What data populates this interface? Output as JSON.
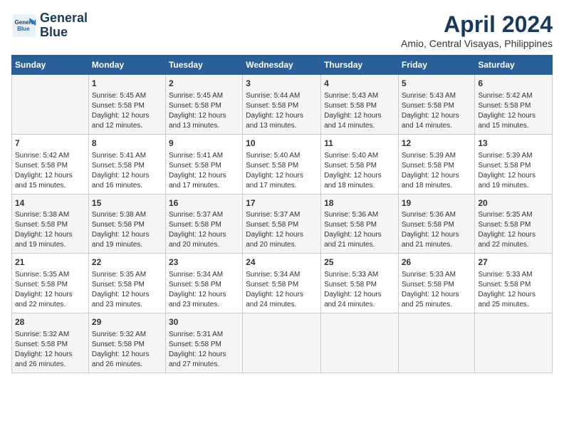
{
  "logo": {
    "line1": "General",
    "line2": "Blue"
  },
  "title": "April 2024",
  "subtitle": "Amio, Central Visayas, Philippines",
  "headers": [
    "Sunday",
    "Monday",
    "Tuesday",
    "Wednesday",
    "Thursday",
    "Friday",
    "Saturday"
  ],
  "weeks": [
    [
      {
        "day": "",
        "text": ""
      },
      {
        "day": "1",
        "text": "Sunrise: 5:45 AM\nSunset: 5:58 PM\nDaylight: 12 hours\nand 12 minutes."
      },
      {
        "day": "2",
        "text": "Sunrise: 5:45 AM\nSunset: 5:58 PM\nDaylight: 12 hours\nand 13 minutes."
      },
      {
        "day": "3",
        "text": "Sunrise: 5:44 AM\nSunset: 5:58 PM\nDaylight: 12 hours\nand 13 minutes."
      },
      {
        "day": "4",
        "text": "Sunrise: 5:43 AM\nSunset: 5:58 PM\nDaylight: 12 hours\nand 14 minutes."
      },
      {
        "day": "5",
        "text": "Sunrise: 5:43 AM\nSunset: 5:58 PM\nDaylight: 12 hours\nand 14 minutes."
      },
      {
        "day": "6",
        "text": "Sunrise: 5:42 AM\nSunset: 5:58 PM\nDaylight: 12 hours\nand 15 minutes."
      }
    ],
    [
      {
        "day": "7",
        "text": "Sunrise: 5:42 AM\nSunset: 5:58 PM\nDaylight: 12 hours\nand 15 minutes."
      },
      {
        "day": "8",
        "text": "Sunrise: 5:41 AM\nSunset: 5:58 PM\nDaylight: 12 hours\nand 16 minutes."
      },
      {
        "day": "9",
        "text": "Sunrise: 5:41 AM\nSunset: 5:58 PM\nDaylight: 12 hours\nand 17 minutes."
      },
      {
        "day": "10",
        "text": "Sunrise: 5:40 AM\nSunset: 5:58 PM\nDaylight: 12 hours\nand 17 minutes."
      },
      {
        "day": "11",
        "text": "Sunrise: 5:40 AM\nSunset: 5:58 PM\nDaylight: 12 hours\nand 18 minutes."
      },
      {
        "day": "12",
        "text": "Sunrise: 5:39 AM\nSunset: 5:58 PM\nDaylight: 12 hours\nand 18 minutes."
      },
      {
        "day": "13",
        "text": "Sunrise: 5:39 AM\nSunset: 5:58 PM\nDaylight: 12 hours\nand 19 minutes."
      }
    ],
    [
      {
        "day": "14",
        "text": "Sunrise: 5:38 AM\nSunset: 5:58 PM\nDaylight: 12 hours\nand 19 minutes."
      },
      {
        "day": "15",
        "text": "Sunrise: 5:38 AM\nSunset: 5:58 PM\nDaylight: 12 hours\nand 19 minutes."
      },
      {
        "day": "16",
        "text": "Sunrise: 5:37 AM\nSunset: 5:58 PM\nDaylight: 12 hours\nand 20 minutes."
      },
      {
        "day": "17",
        "text": "Sunrise: 5:37 AM\nSunset: 5:58 PM\nDaylight: 12 hours\nand 20 minutes."
      },
      {
        "day": "18",
        "text": "Sunrise: 5:36 AM\nSunset: 5:58 PM\nDaylight: 12 hours\nand 21 minutes."
      },
      {
        "day": "19",
        "text": "Sunrise: 5:36 AM\nSunset: 5:58 PM\nDaylight: 12 hours\nand 21 minutes."
      },
      {
        "day": "20",
        "text": "Sunrise: 5:35 AM\nSunset: 5:58 PM\nDaylight: 12 hours\nand 22 minutes."
      }
    ],
    [
      {
        "day": "21",
        "text": "Sunrise: 5:35 AM\nSunset: 5:58 PM\nDaylight: 12 hours\nand 22 minutes."
      },
      {
        "day": "22",
        "text": "Sunrise: 5:35 AM\nSunset: 5:58 PM\nDaylight: 12 hours\nand 23 minutes."
      },
      {
        "day": "23",
        "text": "Sunrise: 5:34 AM\nSunset: 5:58 PM\nDaylight: 12 hours\nand 23 minutes."
      },
      {
        "day": "24",
        "text": "Sunrise: 5:34 AM\nSunset: 5:58 PM\nDaylight: 12 hours\nand 24 minutes."
      },
      {
        "day": "25",
        "text": "Sunrise: 5:33 AM\nSunset: 5:58 PM\nDaylight: 12 hours\nand 24 minutes."
      },
      {
        "day": "26",
        "text": "Sunrise: 5:33 AM\nSunset: 5:58 PM\nDaylight: 12 hours\nand 25 minutes."
      },
      {
        "day": "27",
        "text": "Sunrise: 5:33 AM\nSunset: 5:58 PM\nDaylight: 12 hours\nand 25 minutes."
      }
    ],
    [
      {
        "day": "28",
        "text": "Sunrise: 5:32 AM\nSunset: 5:58 PM\nDaylight: 12 hours\nand 26 minutes."
      },
      {
        "day": "29",
        "text": "Sunrise: 5:32 AM\nSunset: 5:58 PM\nDaylight: 12 hours\nand 26 minutes."
      },
      {
        "day": "30",
        "text": "Sunrise: 5:31 AM\nSunset: 5:58 PM\nDaylight: 12 hours\nand 27 minutes."
      },
      {
        "day": "",
        "text": ""
      },
      {
        "day": "",
        "text": ""
      },
      {
        "day": "",
        "text": ""
      },
      {
        "day": "",
        "text": ""
      }
    ]
  ]
}
